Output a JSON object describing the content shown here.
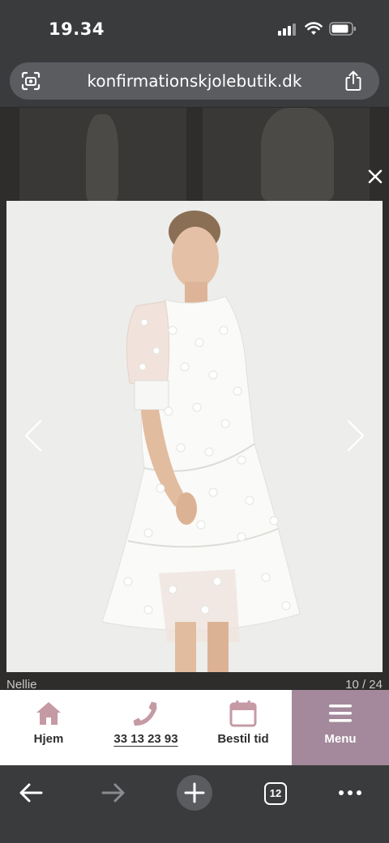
{
  "status_bar": {
    "time": "19.34"
  },
  "browser": {
    "url": "konfirmationskjolebutik.dk",
    "tab_count": "12",
    "icons": {
      "left": "visual-lookup-icon",
      "share": "share-icon",
      "back": "back-arrow-icon",
      "forward": "forward-arrow-icon",
      "new_tab": "plus-icon",
      "tabs": "tabs-icon",
      "more": "more-icon"
    }
  },
  "lightbox": {
    "caption": "Nellie",
    "counter": "10 / 24",
    "image_alt_icon": "dress-photo"
  },
  "site_nav": {
    "items": [
      {
        "label": "Hjem",
        "icon": "home-icon"
      },
      {
        "label": "33 13 23 93",
        "icon": "phone-icon"
      },
      {
        "label": "Bestil tid",
        "icon": "calendar-icon"
      },
      {
        "label": "Menu",
        "icon": "menu-icon"
      }
    ]
  },
  "colors": {
    "accent": "#a3899b",
    "icon_pink": "#c59aa4",
    "chrome": "#3a3b3d"
  }
}
